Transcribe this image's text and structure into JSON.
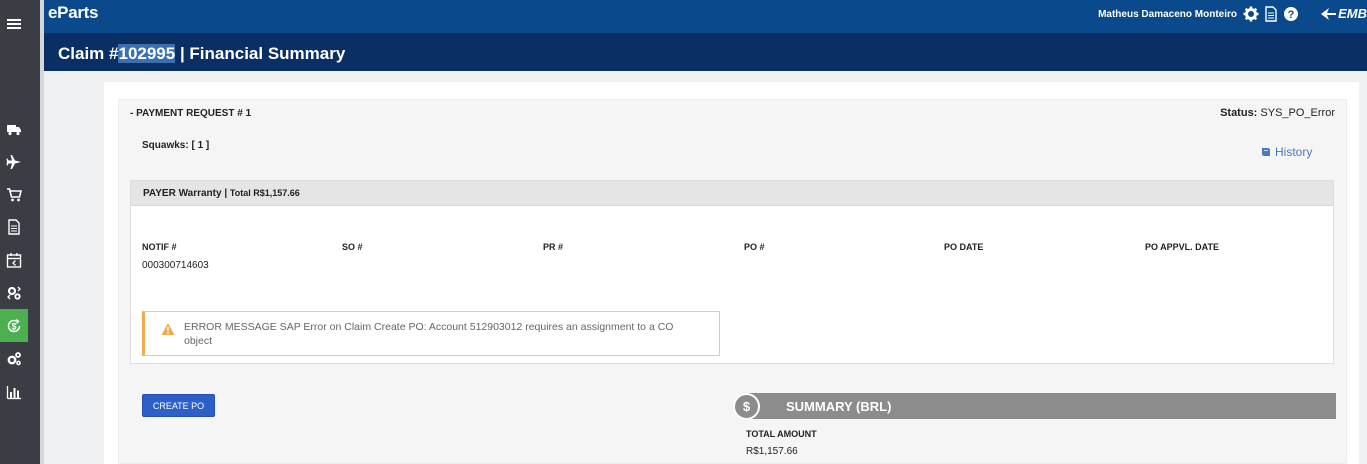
{
  "header": {
    "brand": "eParts",
    "user_name": "Matheus Damaceno Monteiro",
    "logo_text": "EMB"
  },
  "sidebar": {
    "items": [
      {
        "icon": "menu-icon"
      },
      {
        "icon": "truck-icon"
      },
      {
        "icon": "airplane-icon"
      },
      {
        "icon": "cart-icon"
      },
      {
        "icon": "document-icon"
      },
      {
        "icon": "calendar-icon"
      },
      {
        "icon": "cogs-exchange-icon"
      },
      {
        "icon": "money-cycle-icon",
        "active": true
      },
      {
        "icon": "gears-icon"
      },
      {
        "icon": "bar-chart-icon"
      }
    ],
    "active_color": "#4caf50"
  },
  "title": {
    "prefix": "Claim #",
    "claim_number": "102995",
    "suffix": " | Financial Summary"
  },
  "payment": {
    "title": "- PAYMENT REQUEST # 1",
    "status_label": "Status:",
    "status_value": "SYS_PO_Error",
    "squawks": "Squawks: [ 1 ]",
    "history_label": "History"
  },
  "payer": {
    "title": "PAYER Warranty | ",
    "total": "Total R$1,157.66",
    "columns": [
      "NOTIF #",
      "SO #",
      "PR #",
      "PO #",
      "PO DATE",
      "PO APPVL. DATE"
    ],
    "notif_value": "000300714603"
  },
  "error": {
    "message": "ERROR MESSAGE SAP Error on Claim Create PO: Account 512903012 requires an assignment to a CO object",
    "color": "#f0ad4e"
  },
  "actions": {
    "create_po": "CREATE PO"
  },
  "summary": {
    "title": "SUMMARY (BRL)",
    "symbol": "$",
    "total_label": "TOTAL AMOUNT",
    "total_value": "R$1,157.66"
  }
}
